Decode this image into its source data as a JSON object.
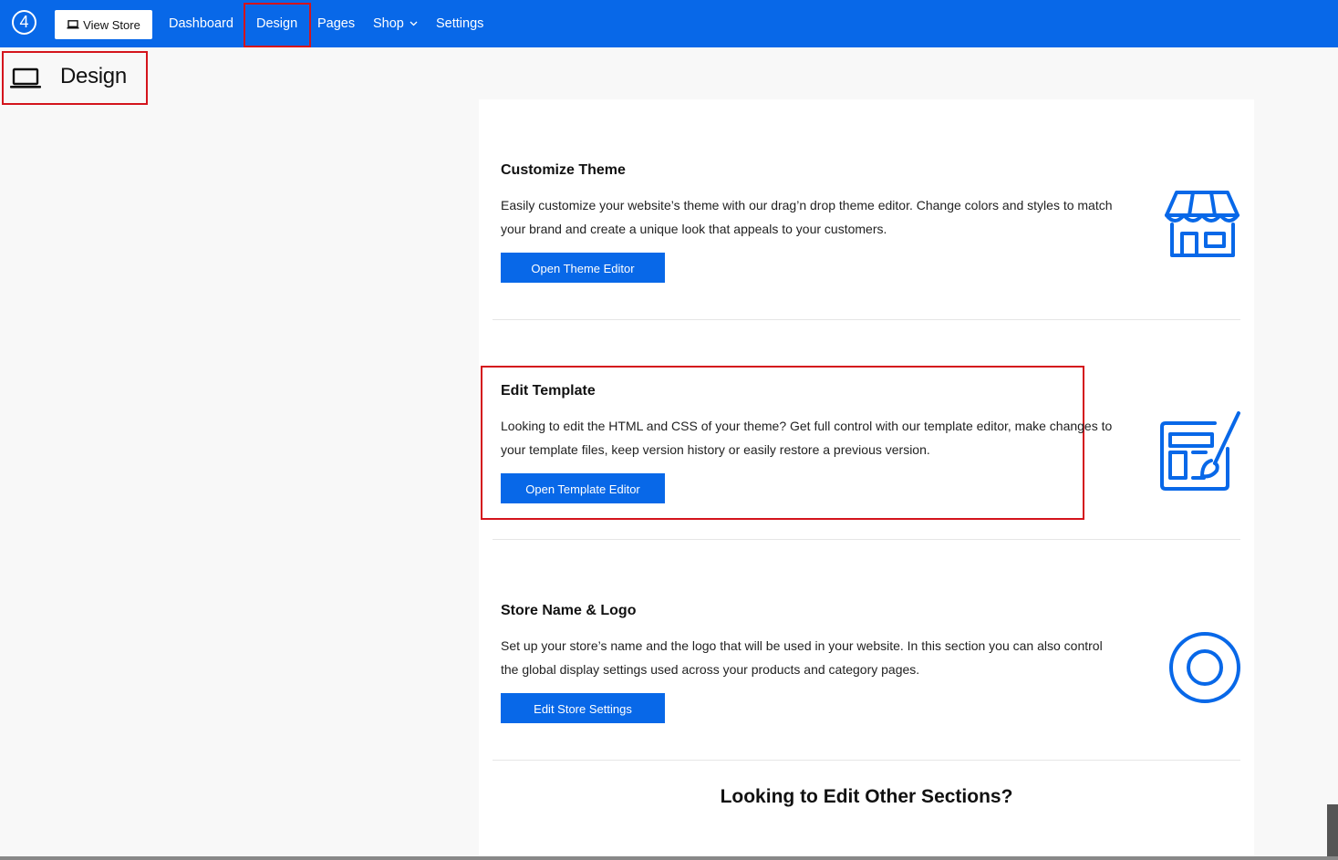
{
  "nav": {
    "logo_text": "4",
    "view_store": "View Store",
    "items": [
      "Dashboard",
      "Design",
      "Pages",
      "Shop",
      "Settings"
    ]
  },
  "page": {
    "title": "Design"
  },
  "sections": [
    {
      "title": "Customize Theme",
      "description": "Easily customize your website’s theme with our drag’n drop theme editor. Change colors and styles to match your brand and create a unique look that appeals to your customers.",
      "button": "Open Theme Editor",
      "icon": "storefront-icon"
    },
    {
      "title": "Edit Template",
      "description": "Looking to edit the HTML and CSS of your theme? Get full control with our template editor, make changes to your template files, keep version history or easily restore a previous version.",
      "button": "Open Template Editor",
      "icon": "template-brush-icon"
    },
    {
      "title": "Store Name & Logo",
      "description": "Set up your store’s name and the logo that will be used in your website. In this section you can also control the global display settings used across your products and category pages.",
      "button": "Edit Store Settings",
      "icon": "logo-circle-icon"
    }
  ],
  "other_sections_heading": "Looking to Edit Other Sections?",
  "colors": {
    "brand_blue": "#0868e8",
    "highlight_red": "#d4141c"
  }
}
